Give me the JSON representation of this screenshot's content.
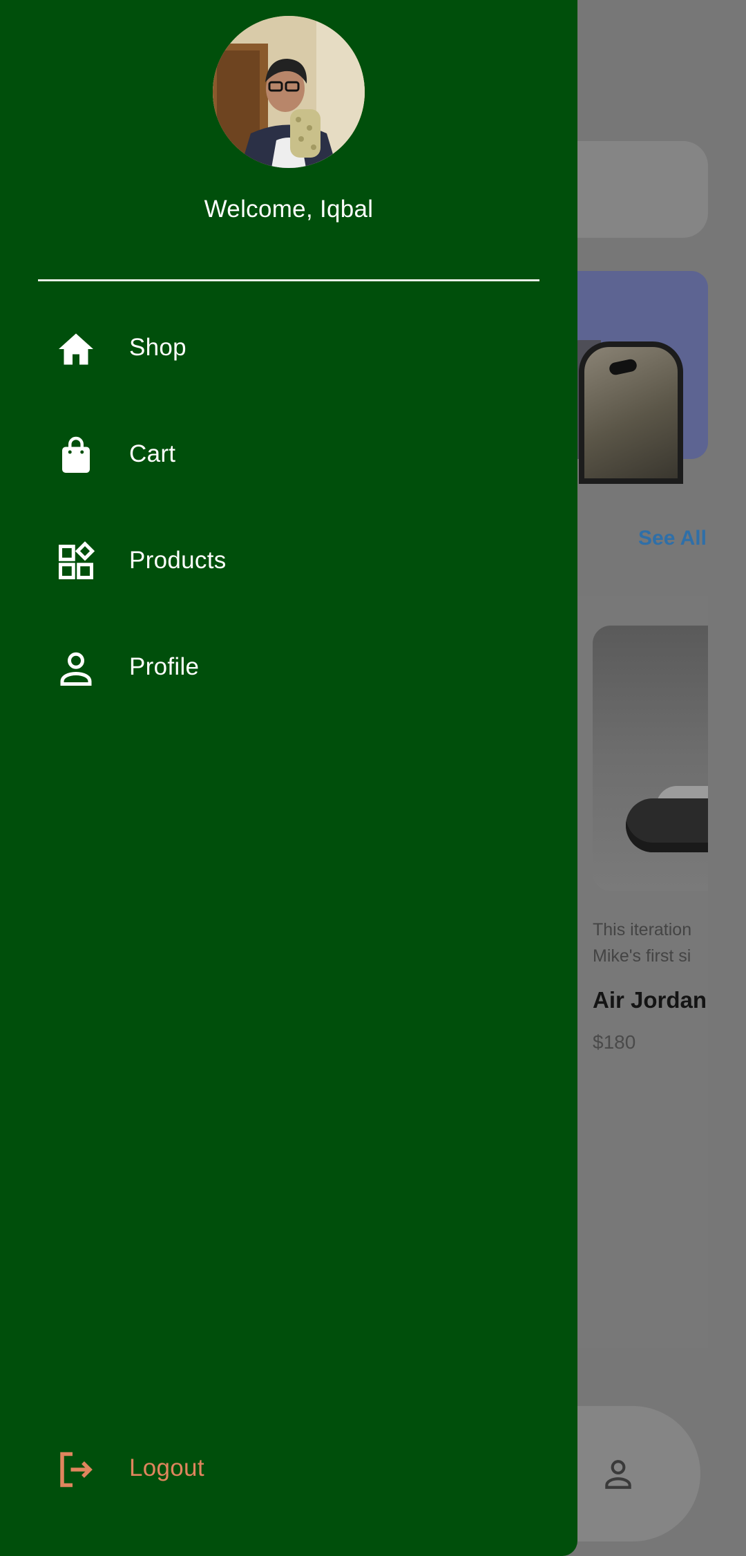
{
  "drawer": {
    "welcome_text": "Welcome, Iqbal",
    "items": [
      {
        "label": "Shop",
        "icon": "home-icon"
      },
      {
        "label": "Cart",
        "icon": "shopping-bag-icon"
      },
      {
        "label": "Products",
        "icon": "widgets-icon"
      },
      {
        "label": "Profile",
        "icon": "person-icon"
      }
    ],
    "logout_label": "Logout",
    "logout_icon": "logout-icon"
  },
  "background": {
    "see_all_label": "See All",
    "product": {
      "description_line1": "This iteration",
      "description_line2": "Mike's first si",
      "title": "Air Jordan",
      "price": "$180"
    }
  },
  "colors": {
    "drawer_bg": "#004f0b",
    "drawer_text": "#ffffff",
    "logout": "#e0855e",
    "scrim": "#777777",
    "link": "#2f6fa8"
  }
}
